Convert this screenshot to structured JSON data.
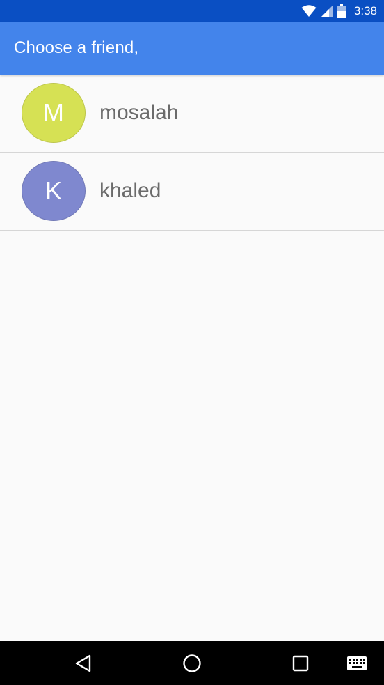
{
  "status_bar": {
    "time": "3:38",
    "icons": [
      "wifi-icon",
      "signal-icon",
      "battery-icon"
    ],
    "background_color": "#0a4fc3"
  },
  "app_bar": {
    "title": "Choose a friend,",
    "background_color": "#4384eb"
  },
  "friends": [
    {
      "initial": "M",
      "name": "mosalah",
      "avatar_color": "#d6e154"
    },
    {
      "initial": "K",
      "name": "khaled",
      "avatar_color": "#7f88cf"
    }
  ],
  "nav_bar": {
    "icons": [
      "back-icon",
      "home-icon",
      "recents-icon",
      "keyboard-icon"
    ]
  }
}
